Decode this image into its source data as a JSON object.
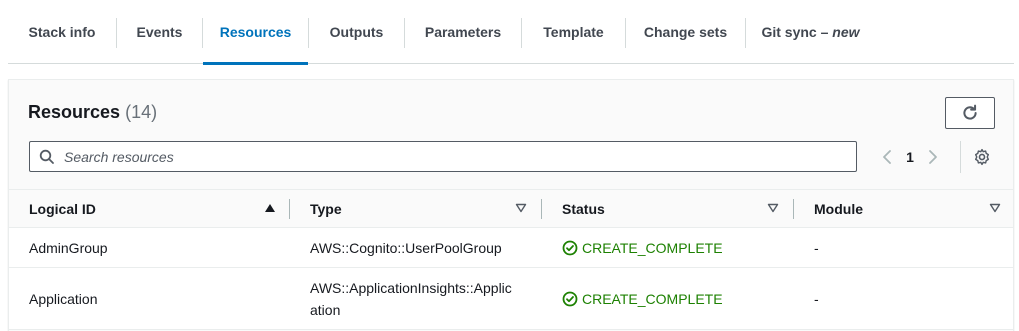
{
  "tabs": [
    {
      "label": "Stack info"
    },
    {
      "label": "Events"
    },
    {
      "label": "Resources"
    },
    {
      "label": "Outputs"
    },
    {
      "label": "Parameters"
    },
    {
      "label": "Template"
    },
    {
      "label": "Change sets"
    },
    {
      "label": "Git sync – ",
      "badge": "new"
    }
  ],
  "active_tab": "Resources",
  "panel": {
    "title": "Resources",
    "count": "(14)"
  },
  "search": {
    "placeholder": "Search resources",
    "value": ""
  },
  "pagination": {
    "current_page": "1"
  },
  "table": {
    "columns": [
      "Logical ID",
      "Type",
      "Status",
      "Module"
    ],
    "sorted_column": "Logical ID",
    "sort_direction": "ascending",
    "rows": [
      {
        "logical_id": "AdminGroup",
        "type": "AWS::Cognito::UserPoolGroup",
        "status": "CREATE_COMPLETE",
        "module": "-"
      },
      {
        "logical_id": "Application",
        "type_line1": "AWS::ApplicationInsights::Applic",
        "type_line2": "ation",
        "status": "CREATE_COMPLETE",
        "module": "-"
      }
    ]
  },
  "colors": {
    "accent": "#0073bb",
    "success": "#1d8102",
    "text": "#16191f"
  },
  "icons": [
    "refresh-icon",
    "search-icon",
    "chevron-left-icon",
    "chevron-right-icon",
    "settings-gear-icon",
    "sort-ascending-icon",
    "sort-icon",
    "status-success-icon"
  ]
}
